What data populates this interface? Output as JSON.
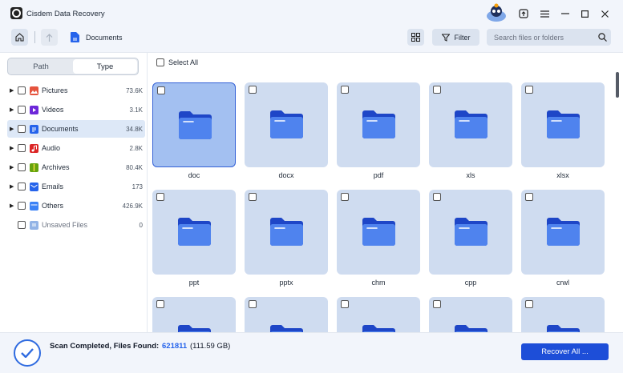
{
  "app": {
    "title": "Cisdem Data Recovery"
  },
  "toolbar": {
    "breadcrumb": "Documents",
    "filter_label": "Filter",
    "search_placeholder": "Search files or folders"
  },
  "sidebar": {
    "tabs": [
      "Path",
      "Type"
    ],
    "active_tab": "Type",
    "items": [
      {
        "label": "Pictures",
        "count": "73.6K",
        "icon": "pictures-icon",
        "color": "#e5533d",
        "expandable": true
      },
      {
        "label": "Videos",
        "count": "3.1K",
        "icon": "videos-icon",
        "color": "#6d28d9",
        "expandable": true
      },
      {
        "label": "Documents",
        "count": "34.8K",
        "icon": "documents-icon",
        "color": "#2563eb",
        "expandable": true,
        "selected": true
      },
      {
        "label": "Audio",
        "count": "2.8K",
        "icon": "audio-icon",
        "color": "#dc2626",
        "expandable": true
      },
      {
        "label": "Archives",
        "count": "80.4K",
        "icon": "archives-icon",
        "color": "#65a30d",
        "expandable": true
      },
      {
        "label": "Emails",
        "count": "173",
        "icon": "emails-icon",
        "color": "#2563eb",
        "expandable": true
      },
      {
        "label": "Others",
        "count": "426.9K",
        "icon": "others-icon",
        "color": "#3b82f6",
        "expandable": true
      },
      {
        "label": "Unsaved Files",
        "count": "0",
        "icon": "unsaved-files-icon",
        "color": "#93b4e6",
        "expandable": false
      }
    ]
  },
  "main": {
    "select_all_label": "Select All",
    "folders": [
      {
        "label": "doc",
        "selected": true
      },
      {
        "label": "docx"
      },
      {
        "label": "pdf"
      },
      {
        "label": "xls"
      },
      {
        "label": "xlsx"
      },
      {
        "label": "ppt"
      },
      {
        "label": "pptx"
      },
      {
        "label": "chm"
      },
      {
        "label": "cpp"
      },
      {
        "label": "crwl"
      },
      {
        "label": ""
      },
      {
        "label": ""
      },
      {
        "label": ""
      },
      {
        "label": ""
      },
      {
        "label": ""
      }
    ]
  },
  "footer": {
    "status_label": "Scan Completed, Files Found:",
    "files_found": "621811",
    "size": "(111.59 GB)",
    "recover_label": "Recover All ..."
  },
  "colors": {
    "accent": "#1d4ed8",
    "folder_blue": "#2f5fe0",
    "card_bg": "#cfdcf0",
    "card_selected_bg": "#a3c0f1"
  }
}
